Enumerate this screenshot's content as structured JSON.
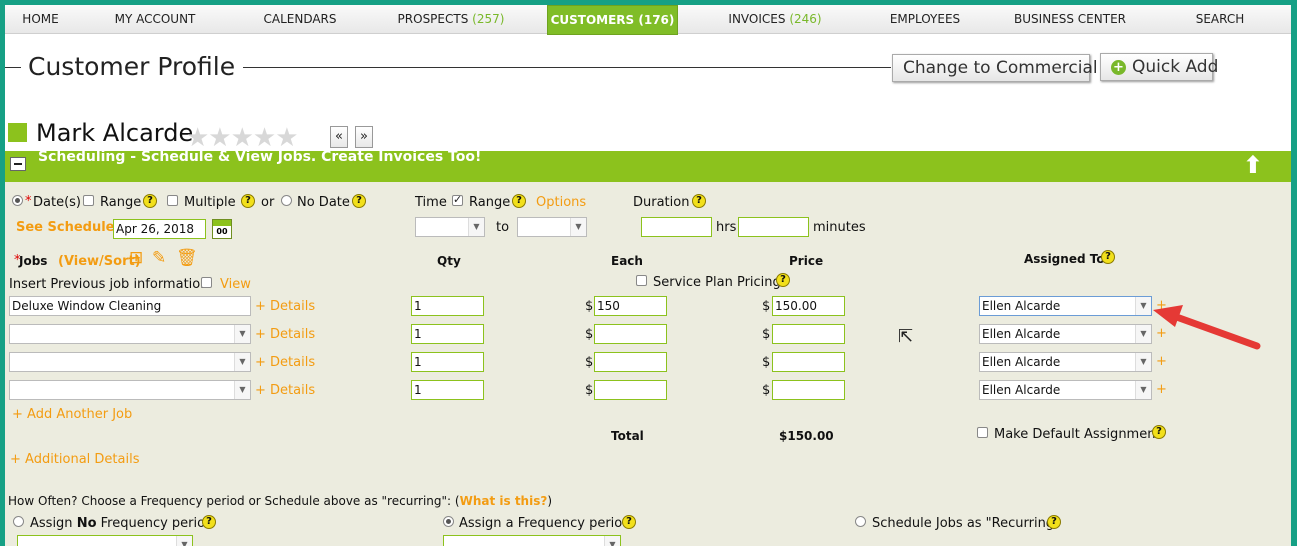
{
  "nav": [
    {
      "label": "HOME",
      "count": ""
    },
    {
      "label": "MY ACCOUNT",
      "count": ""
    },
    {
      "label": "CALENDARS",
      "count": ""
    },
    {
      "label": "PROSPECTS",
      "count": "(257)"
    },
    {
      "label": "CUSTOMERS",
      "count": "(176)"
    },
    {
      "label": "INVOICES",
      "count": "(246)"
    },
    {
      "label": "EMPLOYEES",
      "count": ""
    },
    {
      "label": "BUSINESS CENTER",
      "count": ""
    },
    {
      "label": "SEARCH",
      "count": ""
    }
  ],
  "header": {
    "title": "Customer Profile",
    "change_btn": "Change to Commercial",
    "quick_add_btn": "Quick Add"
  },
  "customer": {
    "name": "Mark Alcarde",
    "stars": "★★★★★",
    "prev": "«",
    "next": "»"
  },
  "section": {
    "title": "Scheduling - Schedule & View Jobs. Create Invoices Too!"
  },
  "date": {
    "required": "*",
    "dates_label": "Date(s)",
    "range": "Range",
    "multiple": "Multiple",
    "or": "or",
    "no_date": "No Date",
    "see_schedule": "See Schedule",
    "date_value": "Apr 26, 2018",
    "cal_icon": "00"
  },
  "time": {
    "label": "Time",
    "range": "Range",
    "options": "Options",
    "to": "to"
  },
  "duration": {
    "label": "Duration",
    "hrs": "hrs",
    "minutes": "minutes"
  },
  "jobs": {
    "required": "*",
    "label": "Jobs",
    "view_sort": "(View/Sort)",
    "insert_prev": "Insert Previous job information",
    "view": "View",
    "qty_header": "Qty",
    "each_header": "Each",
    "price_header": "Price",
    "assigned_header": "Assigned To",
    "service_plan": "Service Plan Pricing",
    "details": "+ Details",
    "currency": "$",
    "plus": "+",
    "rows": [
      {
        "job": "Deluxe Window Cleaning",
        "qty": "1",
        "each": "150",
        "price": "150.00",
        "assigned": "Ellen Alcarde"
      },
      {
        "job": "",
        "qty": "1",
        "each": "",
        "price": "",
        "assigned": "Ellen Alcarde"
      },
      {
        "job": "",
        "qty": "1",
        "each": "",
        "price": "",
        "assigned": "Ellen Alcarde"
      },
      {
        "job": "",
        "qty": "1",
        "each": "",
        "price": "",
        "assigned": "Ellen Alcarde"
      }
    ],
    "add_another": "+ Add Another Job",
    "total_label": "Total",
    "total_value": "$150.00",
    "make_default": "Make Default Assignment",
    "additional": "+ Additional Details"
  },
  "frequency": {
    "question": "How Often? Choose a Frequency period or Schedule above as \"recurring\": (",
    "what_is": "What is this?",
    "close_paren": ")",
    "assign_no_a": "Assign ",
    "assign_no_b": "No",
    "assign_no_c": " Frequency period",
    "assign_freq": "Assign a Frequency period",
    "recurring": "Schedule Jobs as \"Recurring\""
  },
  "help": "?",
  "colors": {
    "accent": "#8cc21d",
    "orange": "#f39c12",
    "frame": "#16a085",
    "arrow": "#e53935"
  }
}
